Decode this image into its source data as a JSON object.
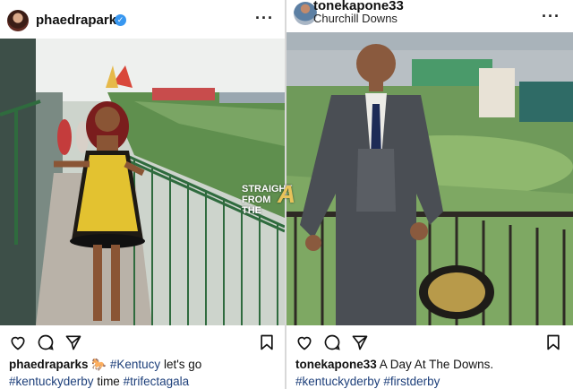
{
  "posts": [
    {
      "username": "phaedraparks",
      "verified": true,
      "caption_user": "phaedraparks",
      "caption_emoji": "🐎",
      "caption_tag1": "#Kentucy",
      "caption_text1": " let's go",
      "caption_tag2": "#kentuckyderby",
      "caption_text2": " time ",
      "caption_tag3": "#trifectagala"
    },
    {
      "username": "tonekapone33",
      "location": "Churchill Downs",
      "caption_user": "tonekapone33",
      "caption_text1": " A Day At The Downs.",
      "caption_tag1": "#kentuckyderby",
      "caption_tag2": "#firstderby"
    }
  ],
  "watermark": {
    "line1": "STRAIGHT",
    "line2": "FROM",
    "line3": "THE",
    "mark": "A"
  },
  "colors": {
    "hashtag": "#1d3f7a",
    "verified": "#3897f0"
  }
}
